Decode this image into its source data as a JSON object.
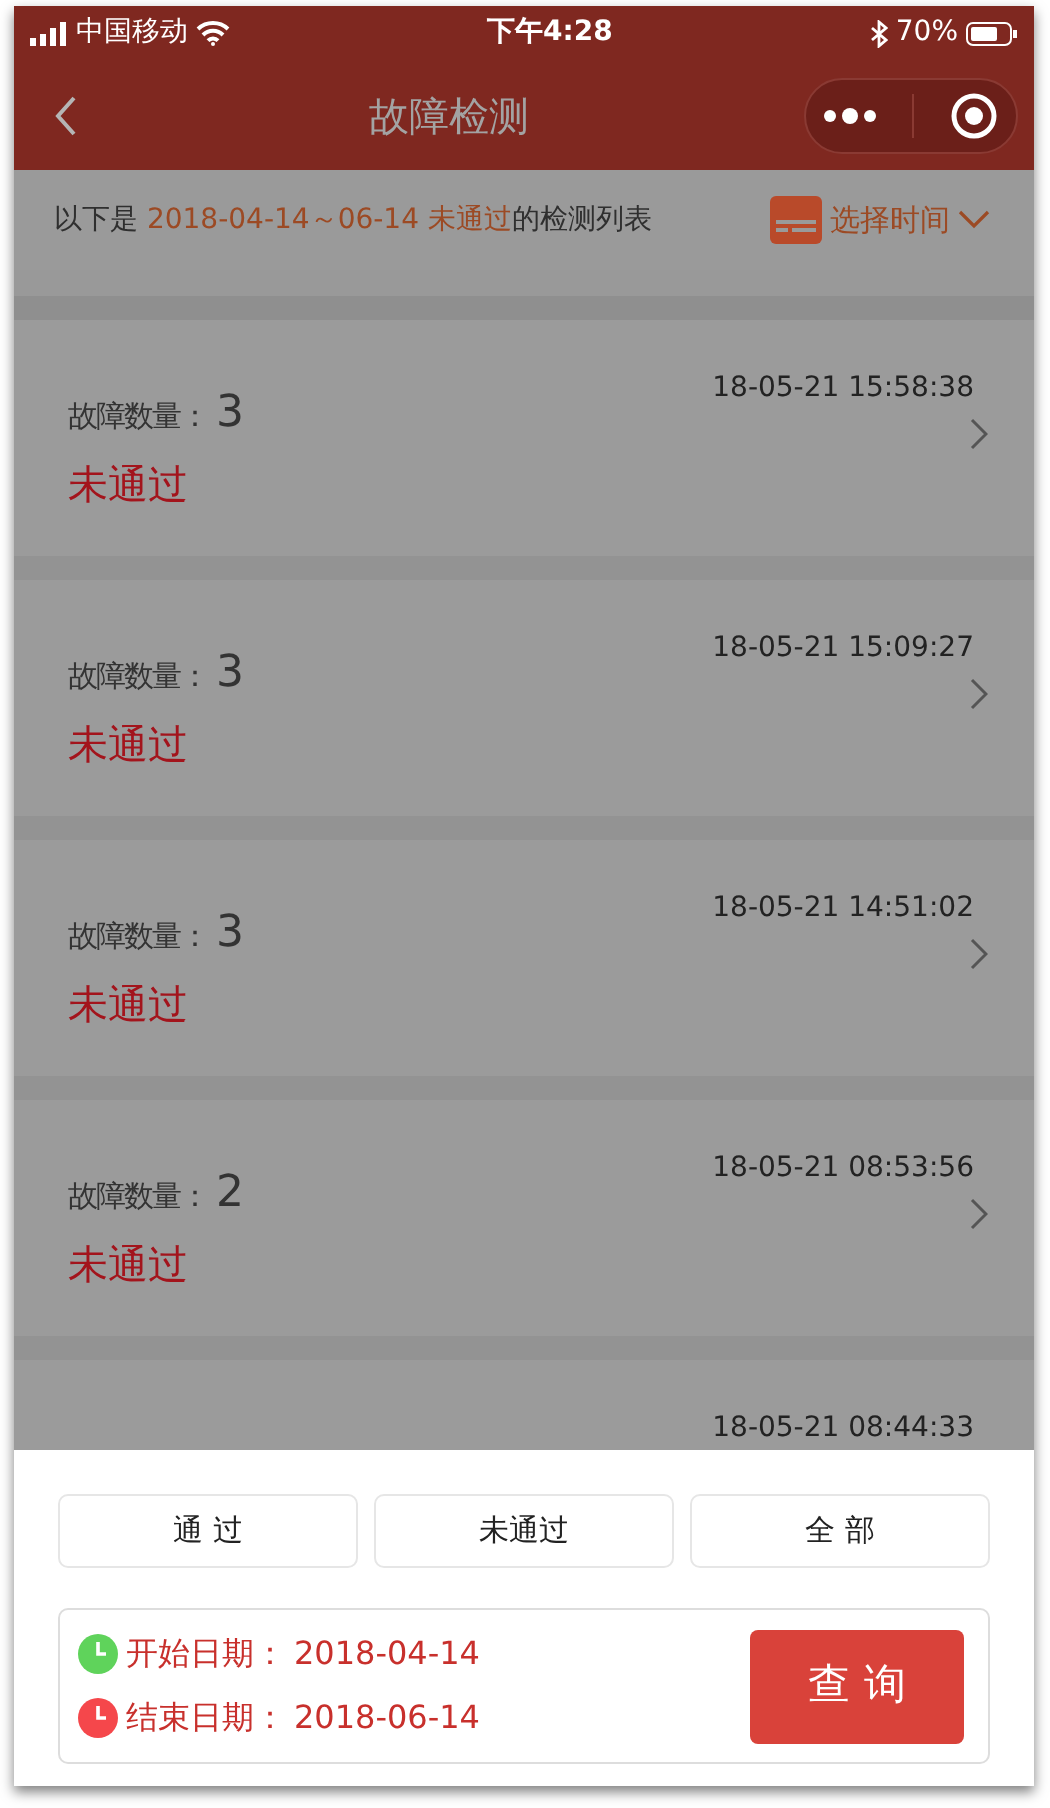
{
  "status_bar": {
    "carrier": "中国移动",
    "time": "下午4:28",
    "battery": "70%"
  },
  "nav_bar": {
    "title": "故障检测"
  },
  "info_bar": {
    "prefix": "以下是 ",
    "highlight": "2018-04-14～06-14 未通过",
    "suffix": "的检测列表",
    "time_picker": "选择时间"
  },
  "records": [
    {
      "label": "故障数量：",
      "count": "3",
      "time": "18-05-21 15:58:38",
      "status": "未通过"
    },
    {
      "label": "故障数量：",
      "count": "3",
      "time": "18-05-21 15:09:27",
      "status": "未通过"
    },
    {
      "label": "故障数量：",
      "count": "3",
      "time": "18-05-21 14:51:02",
      "status": "未通过"
    },
    {
      "label": "故障数量：",
      "count": "2",
      "time": "18-05-21 08:53:56",
      "status": "未通过"
    },
    {
      "time": "18-05-21 08:44:33"
    }
  ],
  "filter_sheet": {
    "options": [
      "通 过",
      "未通过",
      "全 部"
    ],
    "dates": [
      {
        "label": "开始日期：",
        "value": "2018-04-14",
        "color": "#5fd35b"
      },
      {
        "label": "结束日期：",
        "value": "2018-06-14",
        "color": "#f5474b"
      }
    ],
    "query_button": "查 询"
  }
}
